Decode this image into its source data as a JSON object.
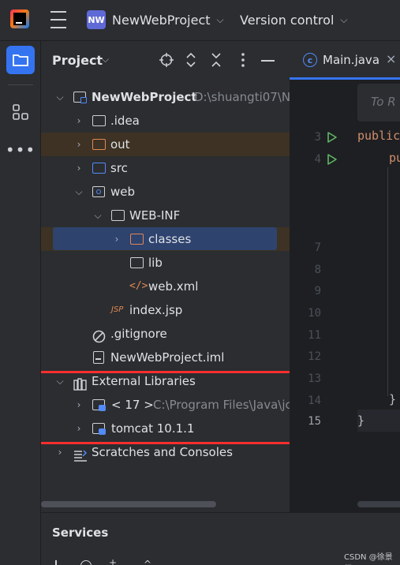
{
  "titlebar": {
    "project_badge": "NW",
    "project_name": "NewWebProject",
    "vcs_label": "Version control"
  },
  "project_panel": {
    "title": "Project",
    "tree": [
      {
        "label": "NewWebProject",
        "path": "D:\\shuangti07\\N"
      },
      {
        "label": ".idea"
      },
      {
        "label": "out"
      },
      {
        "label": "src"
      },
      {
        "label": "web"
      },
      {
        "label": "WEB-INF"
      },
      {
        "label": "classes"
      },
      {
        "label": "lib"
      },
      {
        "label": "web.xml"
      },
      {
        "label": "index.jsp",
        "icon_text": "JSP"
      },
      {
        "label": ".gitignore"
      },
      {
        "label": "NewWebProject.iml"
      },
      {
        "label": "External Libraries"
      },
      {
        "label": "< 17 >",
        "path": "C:\\Program Files\\Java\\jc"
      },
      {
        "label": "tomcat 10.1.1"
      },
      {
        "label": "Scratches and Consoles"
      }
    ],
    "highlight_color": "#f82f2f"
  },
  "editor": {
    "tab_label": "Main.java",
    "banner_text": "To R",
    "line_numbers": [
      "3",
      "4",
      "7",
      "8",
      "9",
      "10",
      "11",
      "12",
      "13",
      "14",
      "15"
    ],
    "code_public": "public",
    "code_pu": "pu",
    "code_brace1": "}",
    "code_brace2": "}"
  },
  "services": {
    "title": "Services"
  },
  "watermark": "CSDN @徐景行"
}
